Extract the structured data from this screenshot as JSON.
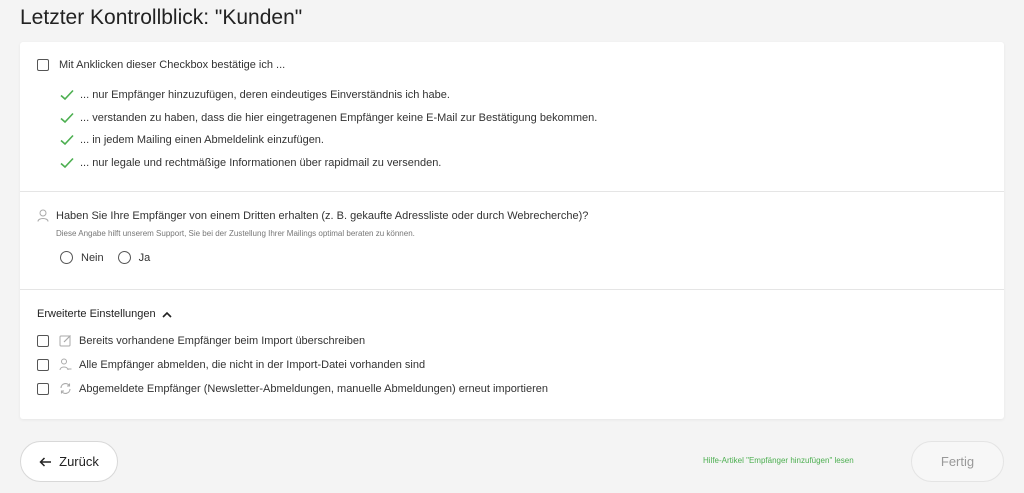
{
  "page": {
    "title": "Letzter Kontrollblick: \"Kunden\""
  },
  "confirmation": {
    "checkbox_label": "Mit Anklicken dieser Checkbox bestätige ich ...",
    "bullets": [
      "... nur Empfänger hinzuzufügen, deren eindeutiges Einverständnis ich habe.",
      "... verstanden zu haben, dass die hier eingetragenen Empfänger keine E-Mail zur Bestätigung bekommen.",
      "... in jedem Mailing einen Abmeldelink einzufügen.",
      "... nur legale und rechtmäßige Informationen über rapidmail zu versenden."
    ],
    "check_color": "#4caf50"
  },
  "third_party": {
    "question": "Haben Sie Ihre Empfänger von einem Dritten erhalten (z. B. gekaufte Adressliste oder durch Webrecherche)?",
    "hint": "Diese Angabe hilft unserem Support, Sie bei der Zustellung Ihrer Mailings optimal beraten zu können.",
    "options": [
      "Nein",
      "Ja"
    ],
    "icon": "user-icon"
  },
  "advanced": {
    "toggle_label": "Erweiterte Einstellungen",
    "expanded": true,
    "options": [
      {
        "label": "Bereits vorhandene Empfänger beim Import überschreiben",
        "icon": "edit-icon"
      },
      {
        "label": "Alle Empfänger abmelden, die nicht in der Import-Datei vorhanden sind",
        "icon": "user-minus-icon"
      },
      {
        "label": "Abgemeldete Empfänger (Newsletter-Abmeldungen, manuelle Abmeldungen) erneut importieren",
        "icon": "refresh-icon"
      }
    ]
  },
  "footer": {
    "back_label": "Zurück",
    "help_link": "Hilfe-Artikel \"Empfänger hinzufügen\" lesen",
    "done_label": "Fertig",
    "link_color": "#4caf50"
  }
}
